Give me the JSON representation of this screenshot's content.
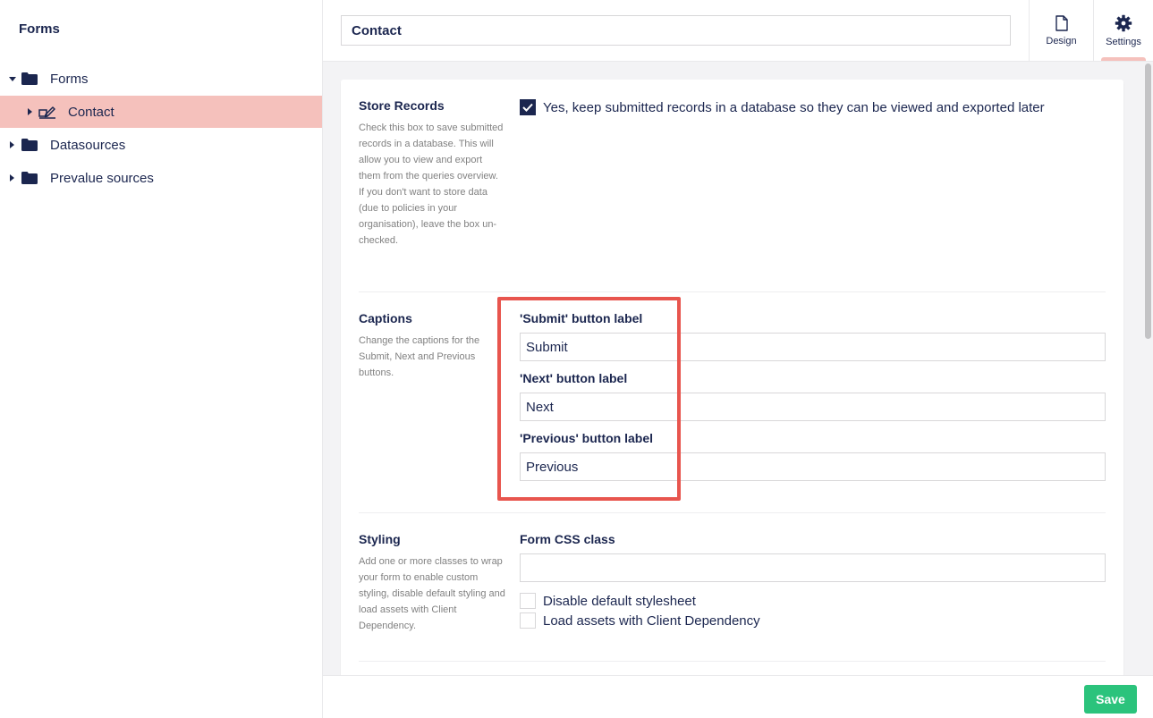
{
  "sidebar": {
    "title": "Forms",
    "items": [
      {
        "label": "Forms"
      },
      {
        "label": "Contact"
      },
      {
        "label": "Datasources"
      },
      {
        "label": "Prevalue sources"
      }
    ]
  },
  "header": {
    "form_name": "Contact",
    "apps": [
      {
        "label": "Design",
        "icon": "document-icon"
      },
      {
        "label": "Settings",
        "icon": "gear-icon"
      }
    ]
  },
  "sections": {
    "store_records": {
      "title": "Store Records",
      "description": "Check this box to save submitted records in a database. This will allow you to view and export them from the queries overview. If you don't want to store data (due to policies in your organisation), leave the box un-checked.",
      "checkbox_label": "Yes, keep submitted records in a database so they can be viewed and exported later",
      "checked": true
    },
    "captions": {
      "title": "Captions",
      "description": "Change the captions for the Submit, Next and Previous buttons.",
      "submit_label": "'Submit' button label",
      "submit_value": "Submit",
      "next_label": "'Next' button label",
      "next_value": "Next",
      "previous_label": "'Previous' button label",
      "previous_value": "Previous"
    },
    "styling": {
      "title": "Styling",
      "description": "Add one or more classes to wrap your form to enable custom styling, disable default styling and load assets with Client Dependency.",
      "css_class_label": "Form CSS class",
      "css_class_value": "",
      "disable_stylesheet_label": "Disable default stylesheet",
      "disable_stylesheet_checked": false,
      "load_assets_label": "Load assets with Client Dependency",
      "load_assets_checked": false
    }
  },
  "footer": {
    "save_label": "Save"
  },
  "colors": {
    "primary": "#1b264f",
    "selected_bg": "#f5c1bc",
    "highlight": "#e8554e",
    "save": "#2bc37c"
  }
}
